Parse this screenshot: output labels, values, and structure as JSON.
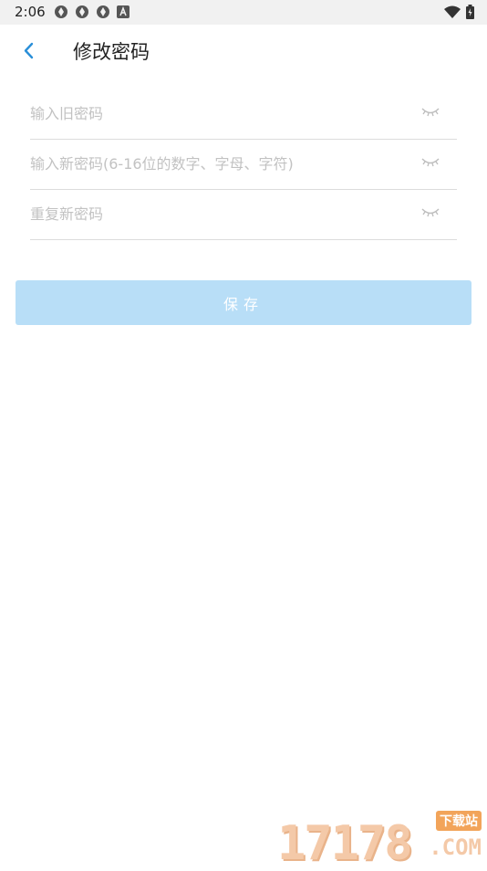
{
  "status_bar": {
    "time": "2:06",
    "left_icons": [
      "settings-icon",
      "settings-icon",
      "settings-icon",
      "app-a-icon"
    ],
    "right_icons": [
      "wifi-icon",
      "battery-icon"
    ]
  },
  "app_bar": {
    "back_icon": "chevron-left-icon",
    "title": "修改密码",
    "accent": "#2a8fd8"
  },
  "form": {
    "old_password": {
      "placeholder": "输入旧密码",
      "value": ""
    },
    "new_password": {
      "placeholder": "输入新密码(6-16位的数字、字母、字符)",
      "value": ""
    },
    "repeat_password": {
      "placeholder": "重复新密码",
      "value": ""
    },
    "toggle_icon": "eye-closed-icon",
    "save_label": "保存",
    "save_color": "#b8def7"
  },
  "watermark": {
    "digits": "17178",
    "badge": "下载站",
    "suffix": ".COM"
  }
}
